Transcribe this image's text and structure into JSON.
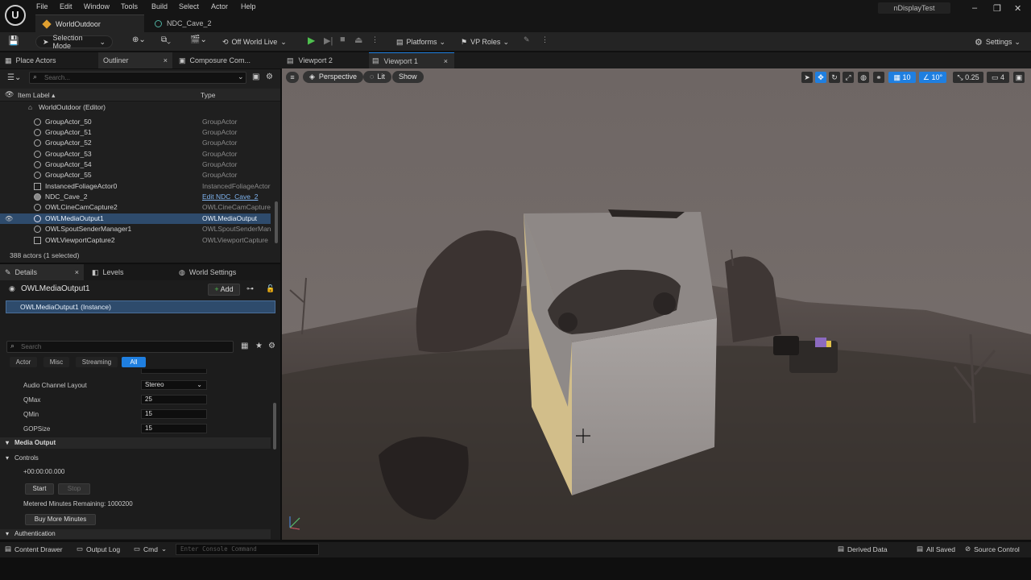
{
  "menu": [
    "File",
    "Edit",
    "Window",
    "Tools",
    "Build",
    "Select",
    "Actor",
    "Help"
  ],
  "doc_tabs": {
    "world": "WorldOutdoor",
    "ndc": "NDC_Cave_2"
  },
  "project_name": "nDisplayTest",
  "toolbar": {
    "selection_mode": "Selection Mode",
    "play_mode": "Off World Live",
    "platforms": "Platforms",
    "vp_roles": "VP Roles",
    "settings": "Settings"
  },
  "left_tabs": [
    "Place Actors",
    "Outliner",
    "Composure Com..."
  ],
  "outliner": {
    "search_placeholder": "Search...",
    "col_label": "Item Label",
    "col_type": "Type",
    "root": "WorldOutdoor (Editor)",
    "rows": [
      {
        "name": "GroupActor_50",
        "type": "GroupActor"
      },
      {
        "name": "GroupActor_51",
        "type": "GroupActor"
      },
      {
        "name": "GroupActor_52",
        "type": "GroupActor"
      },
      {
        "name": "GroupActor_53",
        "type": "GroupActor"
      },
      {
        "name": "GroupActor_54",
        "type": "GroupActor"
      },
      {
        "name": "GroupActor_55",
        "type": "GroupActor"
      },
      {
        "name": "InstancedFoliageActor0",
        "type": "InstancedFoliageActor"
      },
      {
        "name": "NDC_Cave_2",
        "type": "Edit NDC_Cave_2"
      },
      {
        "name": "OWLCineCamCapture2",
        "type": "OWLCineCamCapture"
      },
      {
        "name": "OWLMediaOutput1",
        "type": "OWLMediaOutput"
      },
      {
        "name": "OWLSpoutSenderManager1",
        "type": "OWLSpoutSenderMana"
      },
      {
        "name": "OWLViewportCapture2",
        "type": "OWLViewportCapture"
      }
    ],
    "status": "388 actors (1 selected)"
  },
  "details": {
    "tabs": [
      "Details",
      "Levels",
      "World Settings"
    ],
    "object_name": "OWLMediaOutput1",
    "add_label": "Add",
    "instance": "OWLMediaOutput1 (Instance)",
    "search_placeholder": "Search",
    "filters": [
      "Actor",
      "Misc",
      "Streaming",
      "All"
    ],
    "props": [
      {
        "label": "Audio Channel Layout",
        "value": "Stereo"
      },
      {
        "label": "QMax",
        "value": "25"
      },
      {
        "label": "QMin",
        "value": "15"
      },
      {
        "label": "GOPSize",
        "value": "15"
      }
    ],
    "section_media": "Media Output",
    "section_controls": "Controls",
    "timecode": "+00:00:00.000",
    "start": "Start",
    "stop": "Stop",
    "metered_label": "Metered Minutes Remaining:",
    "metered_value": "1000200",
    "buy": "Buy More Minutes",
    "section_auth": "Authentication"
  },
  "viewport": {
    "tabs": [
      "Viewport 2",
      "Viewport 1"
    ],
    "perspective": "Perspective",
    "lit": "Lit",
    "show": "Show",
    "grid": "10",
    "angle": "10°",
    "scale": "0.25",
    "cam_speed": "4"
  },
  "statusbar": {
    "content_drawer": "Content Drawer",
    "output_log": "Output Log",
    "cmd": "Cmd",
    "console_placeholder": "Enter Console Command",
    "derived": "Derived Data",
    "saved": "All Saved",
    "source": "Source Control"
  }
}
